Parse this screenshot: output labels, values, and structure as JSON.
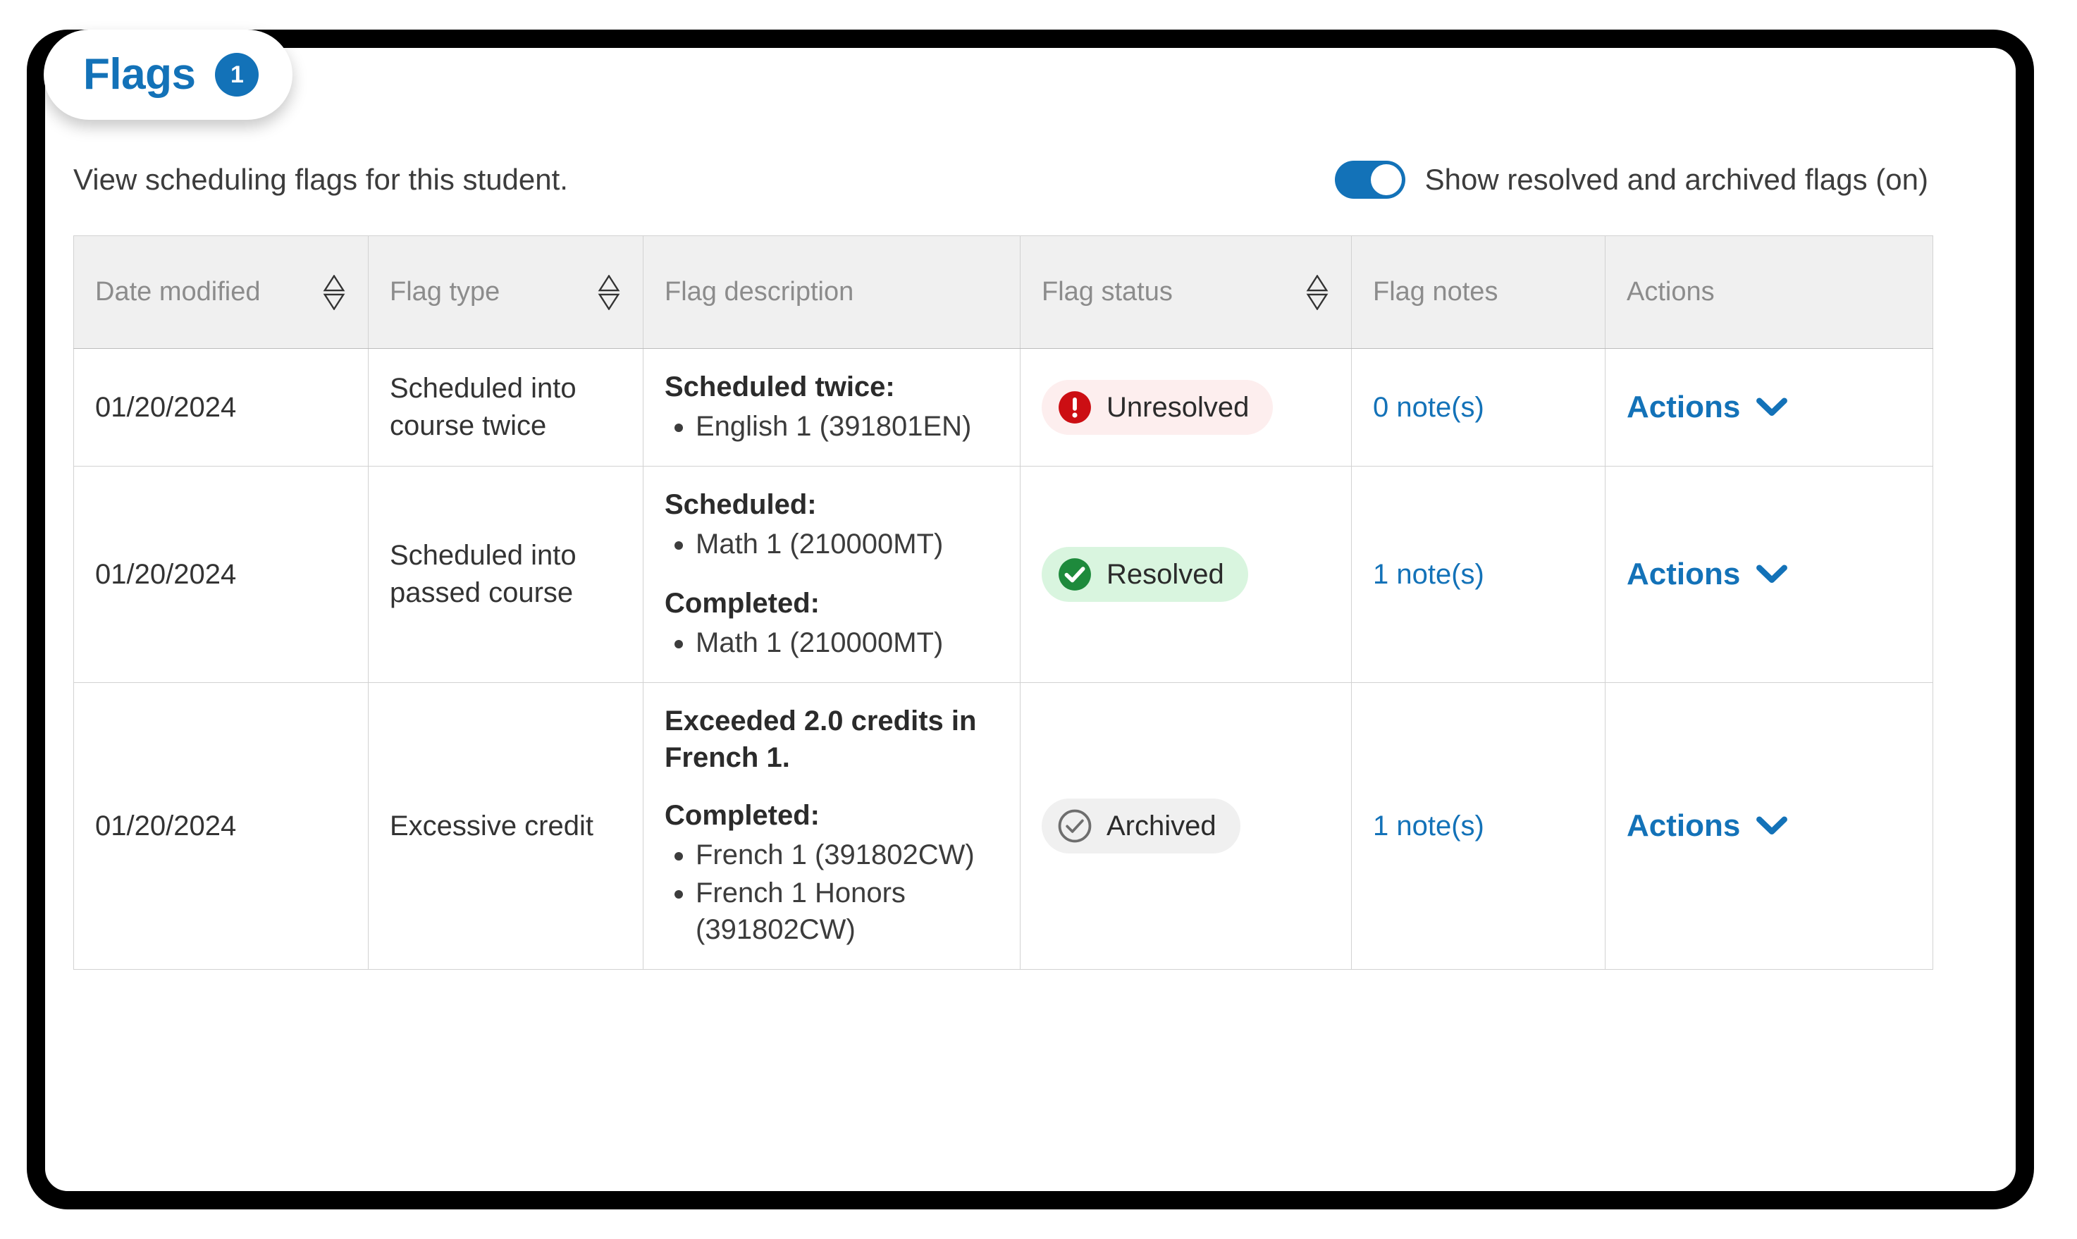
{
  "tab": {
    "label": "Flags",
    "badge_count": "1",
    "accent_color": "#1372b8"
  },
  "header": {
    "intro_text": "View scheduling flags for this student.",
    "toggle": {
      "label": "Show resolved and archived flags (on)",
      "state": "on",
      "on_color": "#1372b8"
    }
  },
  "table": {
    "columns": [
      {
        "label": "Date modified",
        "sortable": true,
        "icon": "sort-icon"
      },
      {
        "label": "Flag type",
        "sortable": true,
        "icon": "sort-icon"
      },
      {
        "label": "Flag description",
        "sortable": false,
        "icon": ""
      },
      {
        "label": "Flag status",
        "sortable": true,
        "icon": "sort-icon"
      },
      {
        "label": "Flag notes",
        "sortable": false,
        "icon": ""
      },
      {
        "label": "Actions",
        "sortable": false,
        "icon": ""
      }
    ],
    "rows": [
      {
        "date_modified": "01/20/2024",
        "flag_type": "Scheduled into course twice",
        "description": [
          {
            "heading": "Scheduled twice:",
            "items": [
              "English 1 (391801EN)"
            ]
          }
        ],
        "status": {
          "label": "Unresolved",
          "kind": "unresolved",
          "icon": "exclamation-circle-icon",
          "icon_color": "#cc0e13",
          "bg_color": "#fdeeee"
        },
        "notes_label": "0 note(s)",
        "actions_label": "Actions"
      },
      {
        "date_modified": "01/20/2024",
        "flag_type": "Scheduled into passed course",
        "description": [
          {
            "heading": "Scheduled:",
            "items": [
              "Math 1 (210000MT)"
            ]
          },
          {
            "heading": "Completed:",
            "items": [
              "Math 1 (210000MT)"
            ]
          }
        ],
        "status": {
          "label": "Resolved",
          "kind": "resolved",
          "icon": "check-circle-filled-icon",
          "icon_color": "#1e8a3c",
          "bg_color": "#d9f5df"
        },
        "notes_label": "1 note(s)",
        "actions_label": "Actions"
      },
      {
        "date_modified": "01/20/2024",
        "flag_type": "Excessive credit",
        "description": [
          {
            "heading": "Exceeded 2.0 credits in French 1.",
            "items": []
          },
          {
            "heading": "Completed:",
            "items": [
              "French 1 (391802CW)",
              "French 1 Honors (391802CW)"
            ]
          }
        ],
        "status": {
          "label": "Archived",
          "kind": "archived",
          "icon": "check-circle-outline-icon",
          "icon_color": "#6e6e6e",
          "bg_color": "#f0f0f0"
        },
        "notes_label": "1 note(s)",
        "actions_label": "Actions"
      }
    ]
  },
  "icons": {
    "sort": "sort-icon",
    "chevron_down": "chevron-down-icon"
  }
}
